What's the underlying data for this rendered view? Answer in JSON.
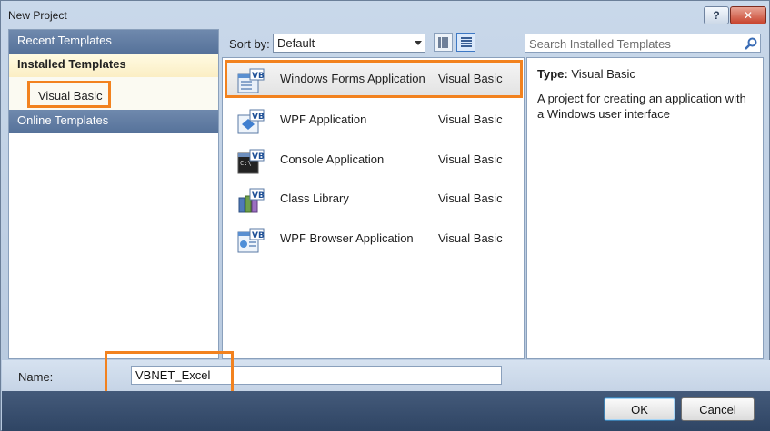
{
  "window": {
    "title": "New Project",
    "help_label": "?",
    "close_label": "✕"
  },
  "left_pane": {
    "recent_templates": "Recent Templates",
    "installed_templates": "Installed Templates",
    "selected_language": "Visual Basic",
    "online_templates": "Online Templates"
  },
  "toolbar": {
    "sort_by_label": "Sort by:",
    "sort_value": "Default",
    "search_placeholder": "Search Installed Templates"
  },
  "templates": [
    {
      "name": "Windows Forms Application",
      "language": "Visual Basic",
      "icon": "windows-forms-icon",
      "selected": true
    },
    {
      "name": "WPF Application",
      "language": "Visual Basic",
      "icon": "wpf-app-icon",
      "selected": false
    },
    {
      "name": "Console Application",
      "language": "Visual Basic",
      "icon": "console-app-icon",
      "selected": false
    },
    {
      "name": "Class Library",
      "language": "Visual Basic",
      "icon": "class-library-icon",
      "selected": false
    },
    {
      "name": "WPF Browser Application",
      "language": "Visual Basic",
      "icon": "wpf-browser-icon",
      "selected": false
    }
  ],
  "details": {
    "type_label": "Type:",
    "type_value": "Visual Basic",
    "description": "A project for creating an application with a Windows user interface"
  },
  "name_row": {
    "label": "Name:",
    "value": "VBNET_Excel"
  },
  "buttons": {
    "ok": "OK",
    "cancel": "Cancel"
  },
  "colors": {
    "highlight": "#f2821f",
    "header_blue": "#56729a",
    "bottom_bar": "#2f4564"
  }
}
